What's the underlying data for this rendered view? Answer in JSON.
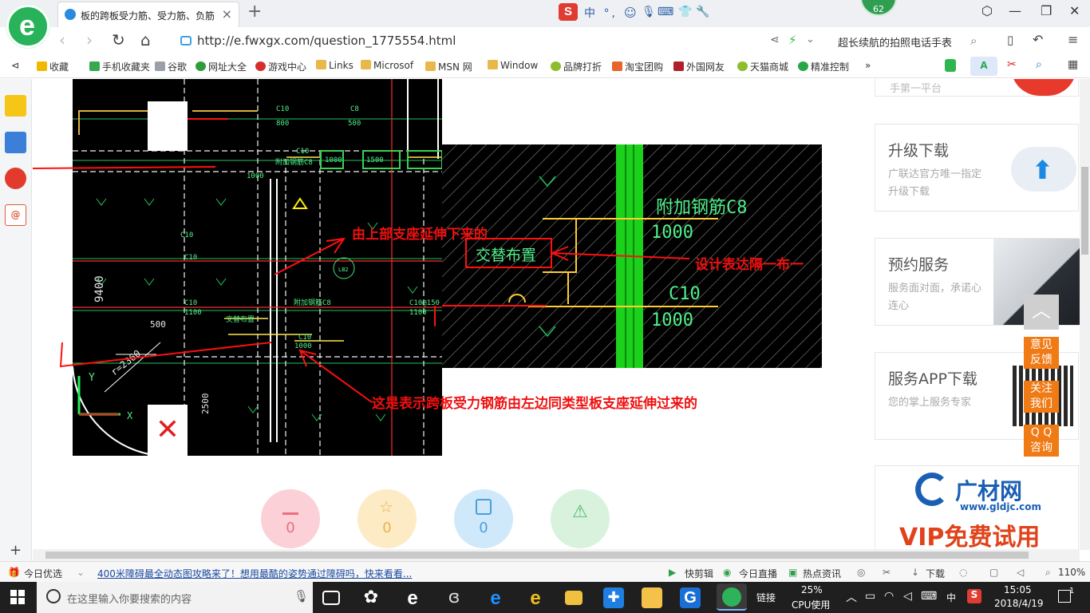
{
  "browser": {
    "tab_title": "板的跨板受力筋、受力筋、负筋",
    "ime_label": "中 °,",
    "badge_count": "62",
    "url": "http://e.fwxgx.com/question_1775554.html",
    "search_text": "超长续航的拍照电话手表"
  },
  "bookmarks": [
    {
      "label": "收藏",
      "color": "#f2b800"
    },
    {
      "label": "手机收藏夹",
      "color": "#36a94f"
    },
    {
      "label": "谷歌",
      "color": "#9aa0a6"
    },
    {
      "label": "网址大全",
      "color": "#2e9c3a"
    },
    {
      "label": "游戏中心",
      "color": "#d62d2d"
    },
    {
      "label": "Links",
      "color": "#e9b84a"
    },
    {
      "label": "Microsof",
      "color": "#e9b84a"
    },
    {
      "label": "MSN 网",
      "color": "#e9b84a"
    },
    {
      "label": "Window",
      "color": "#e9b84a"
    },
    {
      "label": "品牌打折",
      "color": "#8bbd2c"
    },
    {
      "label": "淘宝团购",
      "color": "#e8642c"
    },
    {
      "label": "外国网友",
      "color": "#b0202a"
    },
    {
      "label": "天猫商城",
      "color": "#8bbd2c"
    },
    {
      "label": "精准控制",
      "color": "#28a745"
    }
  ],
  "drawing_annotations": {
    "upper": "由上部支座延伸下来的",
    "design": "设计表达隔一布一",
    "lower": "这是表示跨板受力钢筋由左边同类型板支座延伸过来的"
  },
  "cad_labels": {
    "dim_9400": "9400",
    "dim_500": "500",
    "dim_2500": "2500",
    "radius": "r=2360",
    "c10": "C10",
    "v800": "800",
    "c8": "C8",
    "v500": "500",
    "v1000": "1000",
    "v1500": "1500",
    "v1100": "1100",
    "c10_150": "C10@150",
    "extra_bar_small": "附加钢筋C8",
    "alt_small": "交替布置",
    "extra_bar": "附加钢筋C8",
    "alt": "交替布置",
    "lb2": "LB2",
    "axis_y": "Y",
    "axis_x": "X"
  },
  "actions": [
    {
      "name": "like",
      "count": "0",
      "bg": "#fbd0d6",
      "fg": "#e8707f"
    },
    {
      "name": "favorite",
      "count": "0",
      "bg": "#fdebc6",
      "fg": "#e9b24a"
    },
    {
      "name": "share",
      "count": "0",
      "bg": "#cfe9fb",
      "fg": "#4a9fdc"
    },
    {
      "name": "report",
      "count": "",
      "bg": "#d8f2de",
      "fg": "#56b874"
    }
  ],
  "sidebar": {
    "top_partial": "手第一平台",
    "upgrade_title": "升级下载",
    "upgrade_desc": "广联达官方唯一指定升级下载",
    "booking_title": "预约服务",
    "booking_desc": "服务面对面，承诺心连心",
    "app_title": "服务APP下载",
    "app_desc": "您的掌上服务专家",
    "gcw_logo": "广材网",
    "gcw_url": "www.gldjc.com",
    "vip": "VIP免费试用"
  },
  "float_buttons": {
    "feedback": "意见\n反馈",
    "follow": "关注\n我们",
    "qq": "Q Q\n咨询"
  },
  "statusbar": {
    "today": "今日优选",
    "news": "400米障碍最全动态图攻略来了！想用最酷的姿势通过障碍吗，快来看看...",
    "quick_cut": "快剪辑",
    "live": "今日直播",
    "hot": "热点资讯",
    "download": "下载",
    "zoom": "110%"
  },
  "taskbar": {
    "search_placeholder": "在这里输入你要搜索的内容",
    "link_label": "链接",
    "cpu_percent": "25%",
    "cpu_label": "CPU使用",
    "ime": "中",
    "time": "15:05",
    "date": "2018/4/19",
    "notif": "1"
  }
}
